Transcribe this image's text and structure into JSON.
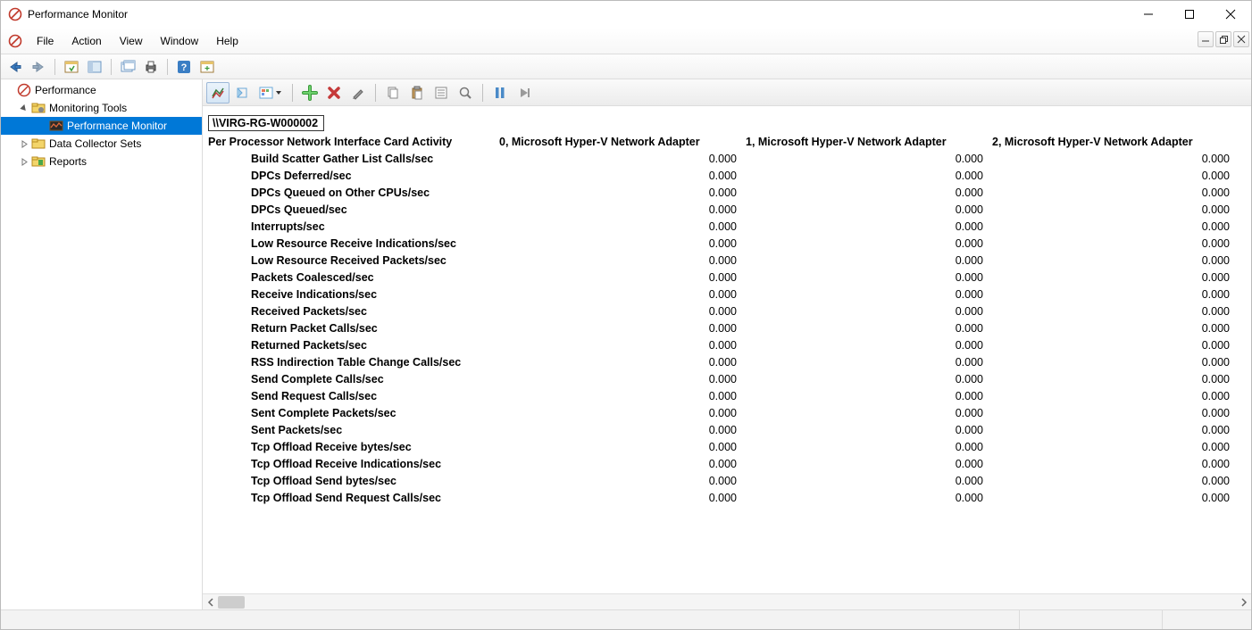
{
  "window": {
    "title": "Performance Monitor"
  },
  "menus": {
    "file": "File",
    "action": "Action",
    "view": "View",
    "window": "Window",
    "help": "Help"
  },
  "tree": {
    "root": "Performance",
    "monitoring_tools": "Monitoring Tools",
    "performance_monitor": "Performance Monitor",
    "data_collector_sets": "Data Collector Sets",
    "reports": "Reports"
  },
  "report": {
    "computer": "\\\\VIRG-RG-W000002",
    "object": "Per Processor Network Interface Card Activity",
    "instances": [
      "0, Microsoft Hyper-V Network Adapter",
      "1, Microsoft Hyper-V Network Adapter",
      "2, Microsoft Hyper-V Network Adapter"
    ],
    "counters": [
      {
        "name": "Build Scatter Gather List Calls/sec",
        "values": [
          "0.000",
          "0.000",
          "0.000"
        ]
      },
      {
        "name": "DPCs Deferred/sec",
        "values": [
          "0.000",
          "0.000",
          "0.000"
        ]
      },
      {
        "name": "DPCs Queued on Other CPUs/sec",
        "values": [
          "0.000",
          "0.000",
          "0.000"
        ]
      },
      {
        "name": "DPCs Queued/sec",
        "values": [
          "0.000",
          "0.000",
          "0.000"
        ]
      },
      {
        "name": "Interrupts/sec",
        "values": [
          "0.000",
          "0.000",
          "0.000"
        ]
      },
      {
        "name": "Low Resource Receive Indications/sec",
        "values": [
          "0.000",
          "0.000",
          "0.000"
        ]
      },
      {
        "name": "Low Resource Received Packets/sec",
        "values": [
          "0.000",
          "0.000",
          "0.000"
        ]
      },
      {
        "name": "Packets Coalesced/sec",
        "values": [
          "0.000",
          "0.000",
          "0.000"
        ]
      },
      {
        "name": "Receive Indications/sec",
        "values": [
          "0.000",
          "0.000",
          "0.000"
        ]
      },
      {
        "name": "Received Packets/sec",
        "values": [
          "0.000",
          "0.000",
          "0.000"
        ]
      },
      {
        "name": "Return Packet Calls/sec",
        "values": [
          "0.000",
          "0.000",
          "0.000"
        ]
      },
      {
        "name": "Returned Packets/sec",
        "values": [
          "0.000",
          "0.000",
          "0.000"
        ]
      },
      {
        "name": "RSS Indirection Table Change Calls/sec",
        "values": [
          "0.000",
          "0.000",
          "0.000"
        ]
      },
      {
        "name": "Send Complete Calls/sec",
        "values": [
          "0.000",
          "0.000",
          "0.000"
        ]
      },
      {
        "name": "Send Request Calls/sec",
        "values": [
          "0.000",
          "0.000",
          "0.000"
        ]
      },
      {
        "name": "Sent Complete Packets/sec",
        "values": [
          "0.000",
          "0.000",
          "0.000"
        ]
      },
      {
        "name": "Sent Packets/sec",
        "values": [
          "0.000",
          "0.000",
          "0.000"
        ]
      },
      {
        "name": "Tcp Offload Receive bytes/sec",
        "values": [
          "0.000",
          "0.000",
          "0.000"
        ]
      },
      {
        "name": "Tcp Offload Receive Indications/sec",
        "values": [
          "0.000",
          "0.000",
          "0.000"
        ]
      },
      {
        "name": "Tcp Offload Send bytes/sec",
        "values": [
          "0.000",
          "0.000",
          "0.000"
        ]
      },
      {
        "name": "Tcp Offload Send Request Calls/sec",
        "values": [
          "0.000",
          "0.000",
          "0.000"
        ]
      }
    ]
  }
}
